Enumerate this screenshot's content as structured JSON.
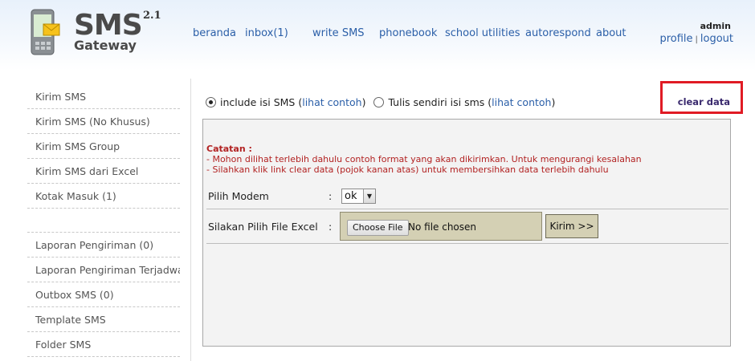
{
  "logo": {
    "title": "SMS",
    "subtitle": "Gateway",
    "version": "2.1",
    "icon": "phone-envelope-icon"
  },
  "topnav": [
    {
      "label": "beranda"
    },
    {
      "label": "inbox(1)"
    },
    {
      "label": "write SMS"
    },
    {
      "label": "phonebook"
    },
    {
      "label": "school utilities"
    },
    {
      "label": "autorespond"
    },
    {
      "label": "about"
    }
  ],
  "user": {
    "name": "admin",
    "profile": "profile",
    "separator": "|",
    "logout": "logout"
  },
  "sidebar": {
    "group1": [
      {
        "label": "Kirim SMS"
      },
      {
        "label": "Kirim SMS (No Khusus)"
      },
      {
        "label": "Kirim SMS Group"
      },
      {
        "label": "Kirim SMS dari Excel"
      },
      {
        "label": "Kotak Masuk (1)"
      }
    ],
    "group2": [
      {
        "label": "Laporan Pengiriman (0)"
      },
      {
        "label": "Laporan Pengiriman Terjadwal"
      },
      {
        "label": "Outbox SMS (0)"
      },
      {
        "label": "Template SMS"
      },
      {
        "label": "Folder SMS"
      }
    ]
  },
  "mode": {
    "option1_label": "include isi SMS",
    "option1_link": "lihat contoh",
    "option2_label": "Tulis sendiri isi sms",
    "option2_link": "lihat contoh",
    "open_paren": "(",
    "close_paren": ")",
    "selected": "option1"
  },
  "clear_data": "clear data",
  "notes": {
    "title": "Catatan :",
    "lines": [
      "- Mohon dilihat terlebih dahulu contoh format yang akan dikirimkan. Untuk mengurangi kesalahan",
      "- Silahkan klik link clear data (pojok kanan atas) untuk membersihkan data terlebih dahulu"
    ]
  },
  "form": {
    "modem_label": "Pilih Modem",
    "colon": ":",
    "modem_value": "ok",
    "file_label": "Silakan Pilih File Excel",
    "choose_file": "Choose File",
    "no_file": "No file chosen",
    "submit": "Kirim >>"
  },
  "colors": {
    "link": "#2b5fa8",
    "note": "#b22222",
    "highlight": "#e01b24",
    "file_area": "#d4d0b4"
  }
}
